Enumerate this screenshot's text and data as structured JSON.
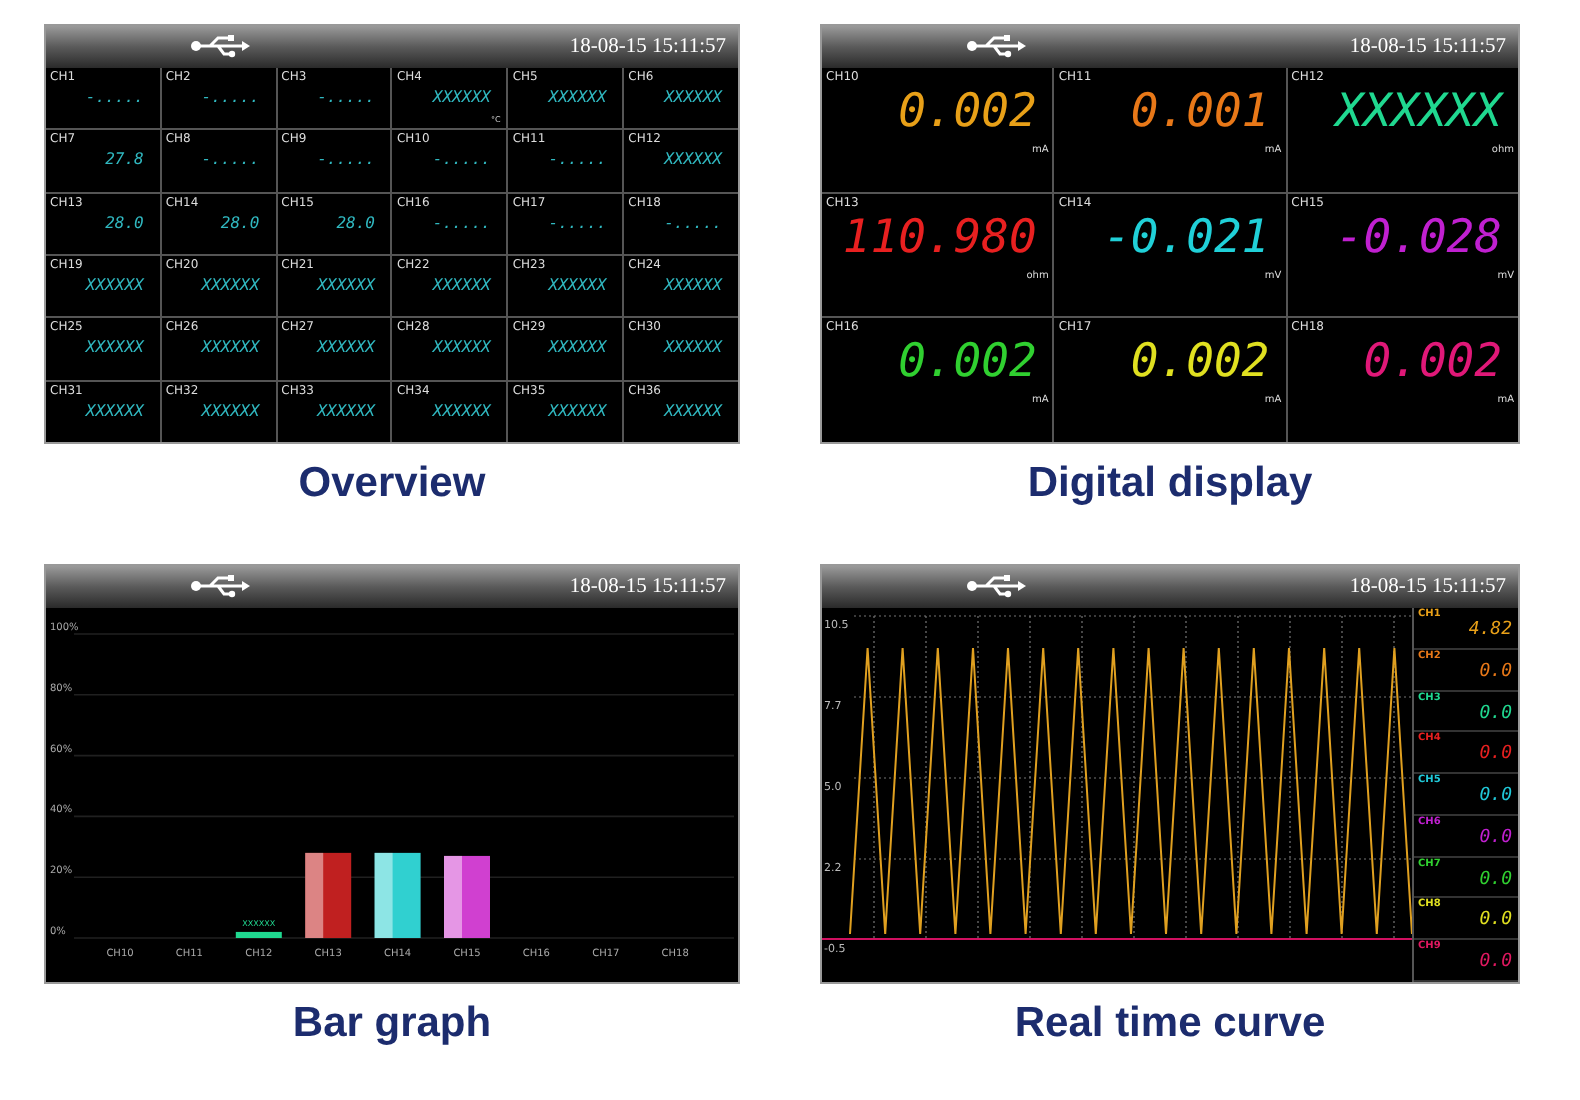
{
  "panels": [
    {
      "kind": "overview",
      "timestamp": "18-08-15 15:11:57",
      "caption": "Overview",
      "cells": [
        {
          "label": "CH1",
          "value": "-....."
        },
        {
          "label": "CH2",
          "value": "-....."
        },
        {
          "label": "CH3",
          "value": "-....."
        },
        {
          "label": "CH4",
          "value": "XXXXXX",
          "unit": "°C"
        },
        {
          "label": "CH5",
          "value": "XXXXXX"
        },
        {
          "label": "CH6",
          "value": "XXXXXX"
        },
        {
          "label": "CH7",
          "value": "27.8"
        },
        {
          "label": "CH8",
          "value": "-....."
        },
        {
          "label": "CH9",
          "value": "-....."
        },
        {
          "label": "CH10",
          "value": "-....."
        },
        {
          "label": "CH11",
          "value": "-....."
        },
        {
          "label": "CH12",
          "value": "XXXXXX"
        },
        {
          "label": "CH13",
          "value": "28.0"
        },
        {
          "label": "CH14",
          "value": "28.0"
        },
        {
          "label": "CH15",
          "value": "28.0"
        },
        {
          "label": "CH16",
          "value": "-....."
        },
        {
          "label": "CH17",
          "value": "-....."
        },
        {
          "label": "CH18",
          "value": "-....."
        },
        {
          "label": "CH19",
          "value": "XXXXXX"
        },
        {
          "label": "CH20",
          "value": "XXXXXX"
        },
        {
          "label": "CH21",
          "value": "XXXXXX"
        },
        {
          "label": "CH22",
          "value": "XXXXXX"
        },
        {
          "label": "CH23",
          "value": "XXXXXX"
        },
        {
          "label": "CH24",
          "value": "XXXXXX"
        },
        {
          "label": "CH25",
          "value": "XXXXXX"
        },
        {
          "label": "CH26",
          "value": "XXXXXX"
        },
        {
          "label": "CH27",
          "value": "XXXXXX"
        },
        {
          "label": "CH28",
          "value": "XXXXXX"
        },
        {
          "label": "CH29",
          "value": "XXXXXX"
        },
        {
          "label": "CH30",
          "value": "XXXXXX"
        },
        {
          "label": "CH31",
          "value": "XXXXXX"
        },
        {
          "label": "CH32",
          "value": "XXXXXX"
        },
        {
          "label": "CH33",
          "value": "XXXXXX"
        },
        {
          "label": "CH34",
          "value": "XXXXXX"
        },
        {
          "label": "CH35",
          "value": "XXXXXX"
        },
        {
          "label": "CH36",
          "value": "XXXXXX"
        }
      ]
    },
    {
      "kind": "digital",
      "timestamp": "18-08-15 15:11:57",
      "caption": "Digital display",
      "cells": [
        {
          "label": "CH10",
          "value": "0.002",
          "unit": "mA",
          "color": "#e8a018"
        },
        {
          "label": "CH11",
          "value": "0.001",
          "unit": "mA",
          "color": "#e87818"
        },
        {
          "label": "CH12",
          "value": "XXXXXX",
          "unit": "ohm",
          "color": "#20d890"
        },
        {
          "label": "CH13",
          "value": "110.980",
          "unit": "ohm",
          "color": "#e82020"
        },
        {
          "label": "CH14",
          "value": "-0.021",
          "unit": "mV",
          "color": "#20d0d8"
        },
        {
          "label": "CH15",
          "value": "-0.028",
          "unit": "mV",
          "color": "#c020d0"
        },
        {
          "label": "CH16",
          "value": "0.002",
          "unit": "mA",
          "color": "#30d030"
        },
        {
          "label": "CH17",
          "value": "0.002",
          "unit": "mA",
          "color": "#e0e020"
        },
        {
          "label": "CH18",
          "value": "0.002",
          "unit": "mA",
          "color": "#e01878"
        }
      ]
    },
    {
      "kind": "bar",
      "timestamp": "18-08-15 15:11:57",
      "caption": "Bar graph",
      "chart_data": {
        "type": "bar",
        "grid": true,
        "categories": [
          "CH10",
          "CH11",
          "CH12",
          "CH13",
          "CH14",
          "CH15",
          "CH16",
          "CH17",
          "CH18"
        ],
        "series": [
          {
            "color": "#20d890",
            "values": [
              null,
              null,
              2,
              null,
              null,
              null,
              null,
              null,
              null
            ]
          },
          {
            "color": "#c02020",
            "values": [
              null,
              null,
              null,
              28,
              null,
              null,
              null,
              null,
              null
            ]
          },
          {
            "color": "#30d0d0",
            "values": [
              null,
              null,
              null,
              null,
              28,
              null,
              null,
              null,
              null
            ]
          },
          {
            "color": "#d040d0",
            "values": [
              null,
              null,
              null,
              null,
              null,
              27,
              null,
              null,
              null
            ]
          }
        ],
        "ylim": [
          0,
          100
        ],
        "yticks": [
          {
            "value": 0,
            "label": "0%"
          },
          {
            "value": 20,
            "label": "20%"
          },
          {
            "value": 40,
            "label": "40%"
          },
          {
            "value": 60,
            "label": "60%"
          },
          {
            "value": 80,
            "label": "80%"
          },
          {
            "value": 100,
            "label": "100%"
          }
        ]
      },
      "first_bar_label": "XXXXXX"
    },
    {
      "kind": "curve",
      "timestamp": "18-08-15 15:11:57",
      "caption": "Real time curve",
      "y_labels": [
        "10.5",
        "7.7",
        "5.0",
        "2.2",
        "-0.5"
      ],
      "channels": [
        {
          "label": "CH1",
          "value": "4.82",
          "color": "#e8a018"
        },
        {
          "label": "CH2",
          "value": "0.0",
          "color": "#e87818"
        },
        {
          "label": "CH3",
          "value": "0.0",
          "color": "#20d890"
        },
        {
          "label": "CH4",
          "value": "0.0",
          "color": "#e82020"
        },
        {
          "label": "CH5",
          "value": "0.0",
          "color": "#20c8d8"
        },
        {
          "label": "CH6",
          "value": "0.0",
          "color": "#c020d0"
        },
        {
          "label": "CH7",
          "value": "0.0",
          "color": "#30d030"
        },
        {
          "label": "CH8",
          "value": "0.0",
          "color": "#e0e020"
        },
        {
          "label": "CH9",
          "value": "0.0",
          "color": "#e01860"
        }
      ]
    }
  ]
}
